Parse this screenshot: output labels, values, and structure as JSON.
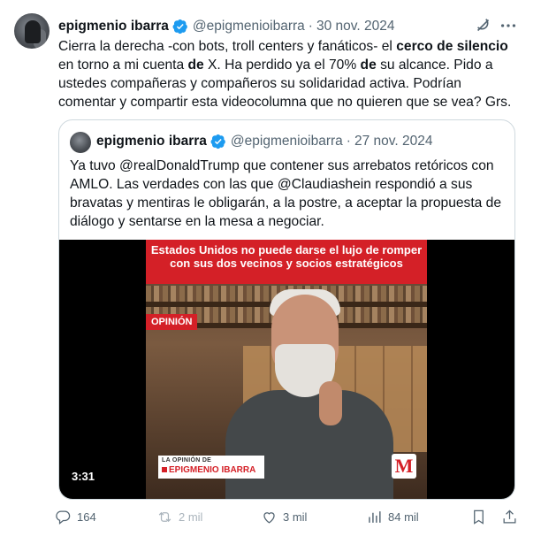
{
  "tweet": {
    "author_name": "epigmenio ibarra",
    "handle": "@epigmenioibarra",
    "separator": "·",
    "date": "30 nov. 2024",
    "text_parts": [
      "Cierra la derecha -con bots, troll centers y fanáticos- el ",
      "cerco de silencio",
      " en torno a mi cuenta ",
      "de",
      " X. Ha perdido ya el 70% ",
      "de",
      " su alcance. Pido a ustedes compañeras y compañeros su solidaridad activa. Podrían comentar y compartir esta videocolumna que no quieren que se vea? Grs."
    ],
    "icons": {
      "verified": "verified-badge-icon",
      "grok": "grok-icon",
      "more": "more-icon"
    },
    "accent_color": "#1d9bf0"
  },
  "quote": {
    "author_name": "epigmenio ibarra",
    "handle": "@epigmenioibarra",
    "separator": "·",
    "date": "27 nov. 2024",
    "text": "Ya tuvo @realDonaldTrump que contener sus arrebatos retóricos con AMLO. Las verdades con las que @Claudiashein respondió a sus bravatas y mentiras le obligarán, a la postre, a aceptar la propuesta de diálogo y sentarse en la mesa a negociar.",
    "video": {
      "banner_text": "Estados Unidos no puede darse el lujo de romper con sus dos vecinos y socios estratégicos",
      "opinion_tag": "OPINIÓN",
      "sticker_line1": "LA OPINIÓN DE",
      "sticker_line2": "EPIGMENIO IBARRA",
      "logo_letter": "M",
      "duration": "3:31",
      "brand_color": "#d42027"
    }
  },
  "actions": {
    "replies": "164",
    "reposts": "2 mil",
    "likes": "3 mil",
    "views": "84 mil",
    "icons": [
      "reply-icon",
      "repost-icon",
      "like-icon",
      "views-icon",
      "bookmark-icon",
      "share-icon"
    ],
    "muted_color": "#536471"
  }
}
